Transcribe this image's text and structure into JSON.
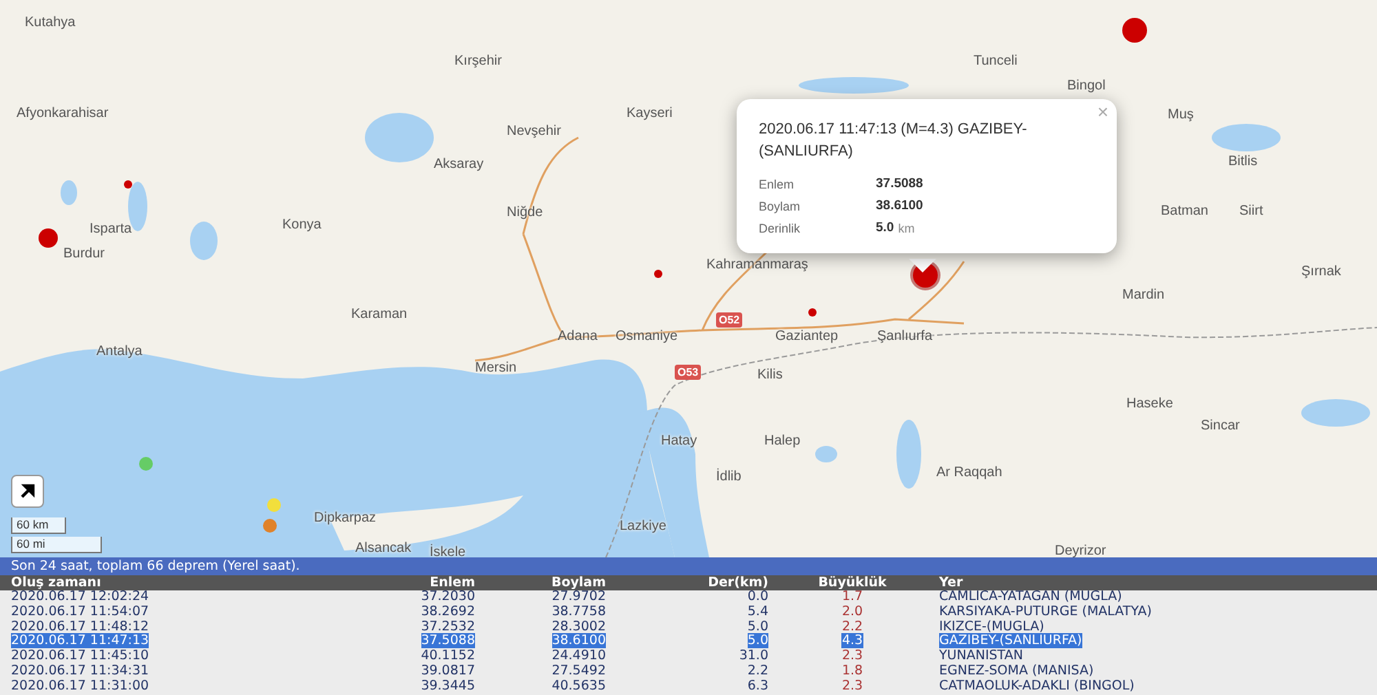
{
  "map": {
    "labels": [
      "Kutahya",
      "Tunceli",
      "Kırşehir",
      "Bingol",
      "Afyonkarahisar",
      "Kayseri",
      "Muş",
      "Nevşehir",
      "Aksaray",
      "Bitlis",
      "Niğde",
      "Batman",
      "Siirt",
      "Kahramanmaraş",
      "Konya",
      "Isparta",
      "Burdur",
      "Şırnak",
      "Mardin",
      "Karaman",
      "Adana",
      "Osmaniye",
      "Gaziantep",
      "Şanlıurfa",
      "Antalya",
      "Mersin",
      "Kilis",
      "Haseke",
      "Sincar",
      "Hatay",
      "Halep",
      "Ar Raqqah",
      "İdlib",
      "Dipkarpaz",
      "Lazkiye",
      "Alsancak",
      "İskele",
      "Deyrizor"
    ],
    "road_shields": [
      "O52",
      "O53"
    ],
    "markers": [
      {
        "color": "#cc0000",
        "selected": false
      },
      {
        "color": "#cc0000",
        "selected": false
      },
      {
        "color": "#cc0000",
        "selected": false
      },
      {
        "color": "#cc0000",
        "selected": false
      },
      {
        "color": "#cc0000",
        "selected": true
      },
      {
        "color": "#cc0000",
        "selected": false
      },
      {
        "color": "#66cc66",
        "selected": false
      },
      {
        "color": "#f2df3c",
        "selected": false
      },
      {
        "color": "#e0822a",
        "selected": false
      }
    ],
    "popup": {
      "title": "2020.06.17 11:47:13 (M=4.3) GAZIBEY-(SANLIURFA)",
      "close": "×",
      "fields": [
        {
          "label": "Enlem",
          "value": "37.5088"
        },
        {
          "label": "Boylam",
          "value": "38.6100"
        },
        {
          "label": "Derinlik",
          "value": "5.0",
          "unit": "km"
        }
      ]
    },
    "scale": [
      "60 km",
      "60 mi"
    ]
  },
  "list": {
    "summary": "Son 24 saat, toplam 66 deprem (Yerel saat).",
    "columns": [
      "Oluş zamanı",
      "Enlem",
      "Boylam",
      "Der(km)",
      "Büyüklük",
      "Yer"
    ],
    "rows": [
      {
        "time": "2020.06.17 12:02:24",
        "lat": "37.2030",
        "lon": "27.9702",
        "depth": "0.0",
        "magnitude": "1.7",
        "place": "CAMLICA-YATAGAN (MUGLA)",
        "selected": false
      },
      {
        "time": "2020.06.17 11:54:07",
        "lat": "38.2692",
        "lon": "38.7758",
        "depth": "5.4",
        "magnitude": "2.0",
        "place": "KARSIYAKA-PUTURGE (MALATYA)",
        "selected": false
      },
      {
        "time": "2020.06.17 11:48:12",
        "lat": "37.2532",
        "lon": "28.3002",
        "depth": "5.0",
        "magnitude": "2.2",
        "place": "IKIZCE-(MUGLA)",
        "selected": false
      },
      {
        "time": "2020.06.17 11:47:13",
        "lat": "37.5088",
        "lon": "38.6100",
        "depth": "5.0",
        "magnitude": "4.3",
        "place": "GAZIBEY-(SANLIURFA)",
        "selected": true
      },
      {
        "time": "2020.06.17 11:45:10",
        "lat": "40.1152",
        "lon": "24.4910",
        "depth": "31.0",
        "magnitude": "2.3",
        "place": "YUNANISTAN",
        "selected": false
      },
      {
        "time": "2020.06.17 11:34:31",
        "lat": "39.0817",
        "lon": "27.5492",
        "depth": "2.2",
        "magnitude": "1.8",
        "place": "EGNEZ-SOMA (MANISA)",
        "selected": false
      },
      {
        "time": "2020.06.17 11:31:00",
        "lat": "39.3445",
        "lon": "40.5635",
        "depth": "6.3",
        "magnitude": "2.3",
        "place": "CATMAOLUK-ADAKLI (BINGOL)",
        "selected": false
      }
    ]
  }
}
